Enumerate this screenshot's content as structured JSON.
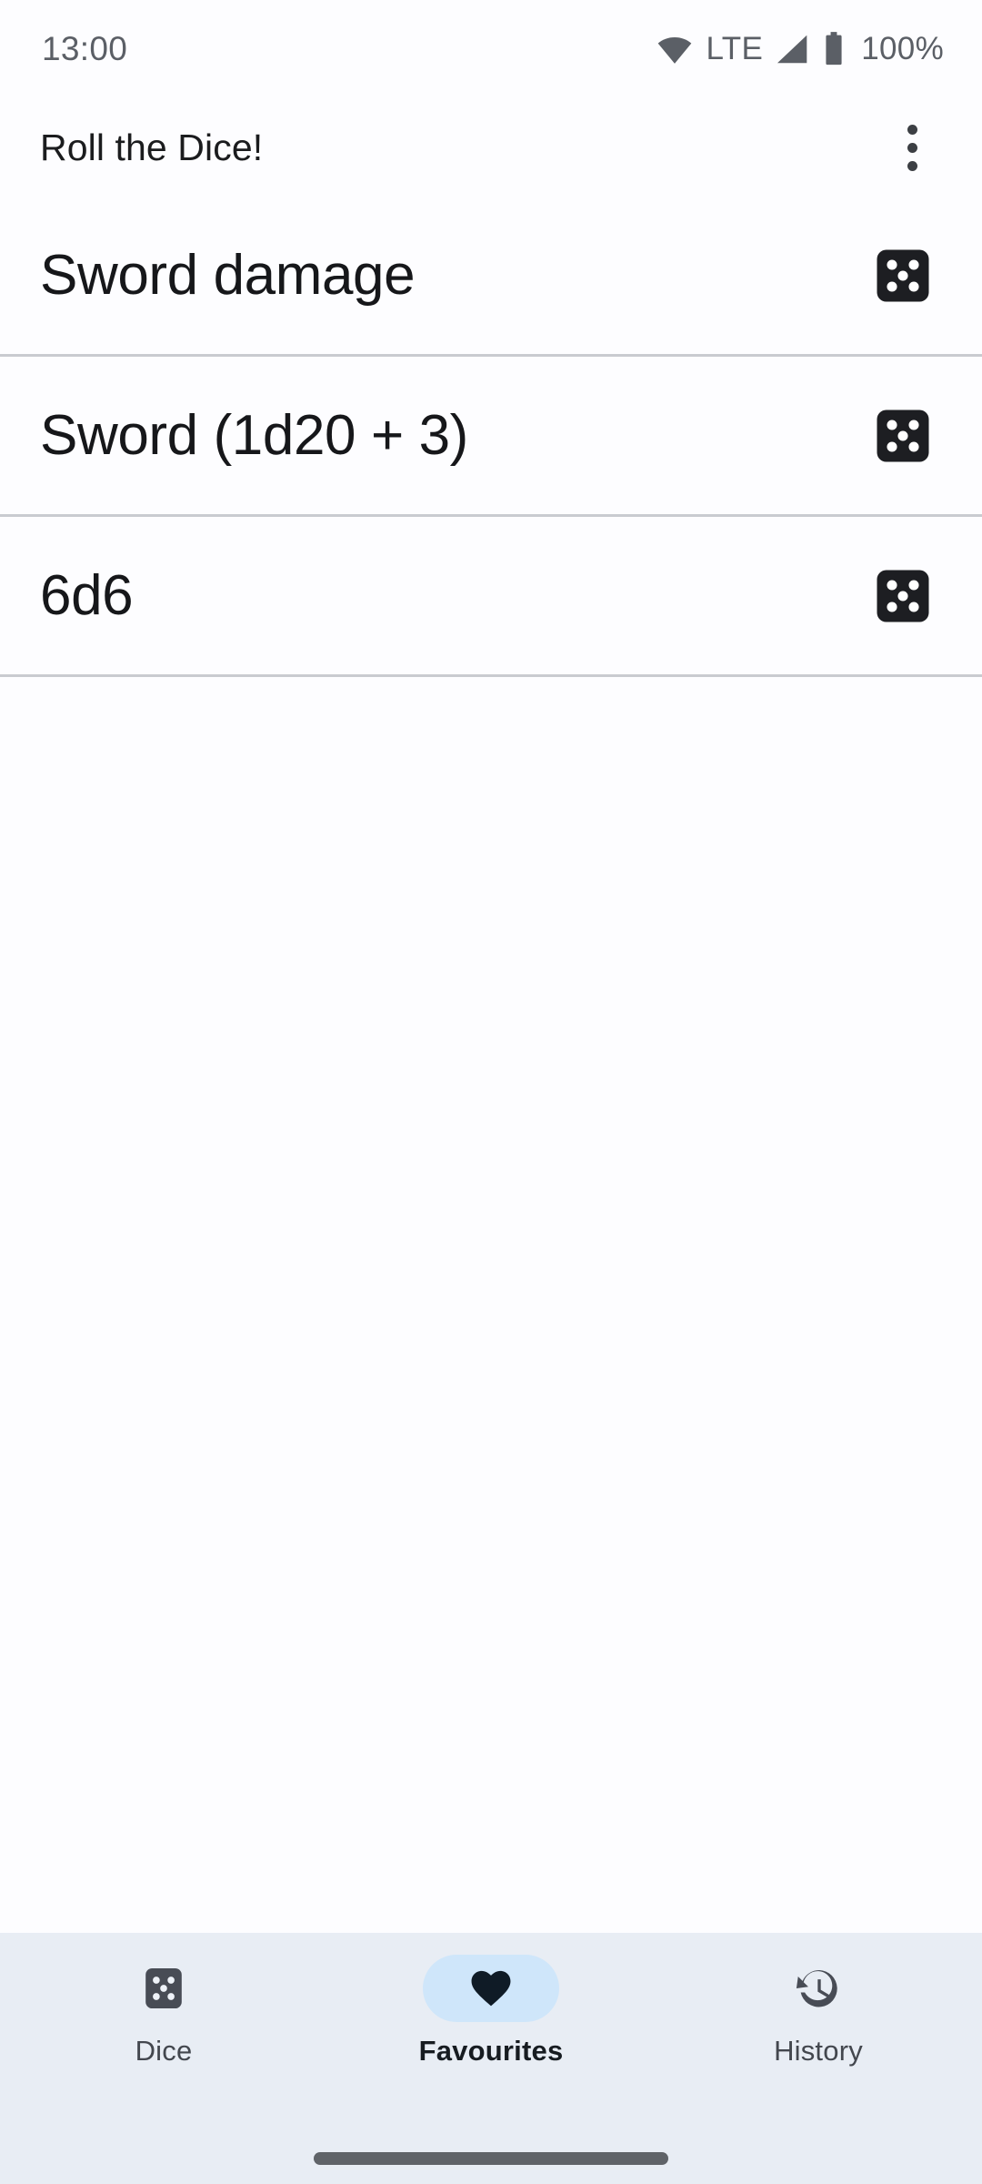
{
  "status_bar": {
    "time": "13:00",
    "network_label": "LTE",
    "battery_percent": "100%",
    "icons": [
      "wifi-icon",
      "signal-icon",
      "battery-icon"
    ],
    "text_color": "#5b5f66"
  },
  "app_bar": {
    "title": "Roll the Dice!",
    "overflow_label": "More options",
    "overflow_icon": "more-vert-icon"
  },
  "list": {
    "items": [
      {
        "label": "Sword damage",
        "icon": "dice-icon",
        "pips": 5
      },
      {
        "label": "Sword (1d20 + 3)",
        "icon": "dice-icon",
        "pips": 5
      },
      {
        "label": "6d6",
        "icon": "dice-icon",
        "pips": 5
      }
    ]
  },
  "bottom_nav": {
    "items": [
      {
        "label": "Dice",
        "icon": "dice-icon",
        "selected": false
      },
      {
        "label": "Favourites",
        "icon": "heart-icon",
        "selected": true
      },
      {
        "label": "History",
        "icon": "history-icon",
        "selected": false
      }
    ],
    "background": "#e8edf4",
    "active_pill_color": "#cfe6fa",
    "active_icon_color": "#0f1b26",
    "inactive_icon_color": "#484c55"
  },
  "colors": {
    "page_background": "#fdfdff",
    "divider": "#c9cbd0",
    "primary_text": "#16171a",
    "dice_icon": "#1d1e22"
  }
}
